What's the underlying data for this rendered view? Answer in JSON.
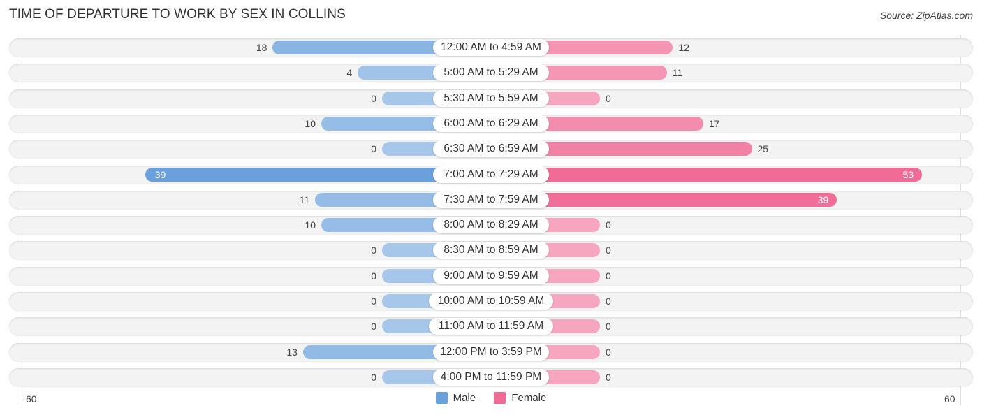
{
  "header": {
    "title": "TIME OF DEPARTURE TO WORK BY SEX IN COLLINS",
    "source": "Source: ZipAtlas.com"
  },
  "colors": {
    "male": "#6aa1dc",
    "male_light": "#a6c7ea",
    "female": "#f06b95",
    "female_light": "#f6a6bf"
  },
  "chart_data": {
    "type": "bar",
    "orientation": "horizontal-diverging",
    "title": "TIME OF DEPARTURE TO WORK BY SEX IN COLLINS",
    "categories": [
      "12:00 AM to 4:59 AM",
      "5:00 AM to 5:29 AM",
      "5:30 AM to 5:59 AM",
      "6:00 AM to 6:29 AM",
      "6:30 AM to 6:59 AM",
      "7:00 AM to 7:29 AM",
      "7:30 AM to 7:59 AM",
      "8:00 AM to 8:29 AM",
      "8:30 AM to 8:59 AM",
      "9:00 AM to 9:59 AM",
      "10:00 AM to 10:59 AM",
      "11:00 AM to 11:59 AM",
      "12:00 PM to 3:59 PM",
      "4:00 PM to 11:59 PM"
    ],
    "series": [
      {
        "name": "Male",
        "values": [
          18,
          4,
          0,
          10,
          0,
          39,
          11,
          10,
          0,
          0,
          0,
          0,
          13,
          0
        ]
      },
      {
        "name": "Female",
        "values": [
          12,
          11,
          0,
          17,
          25,
          53,
          39,
          0,
          0,
          0,
          0,
          0,
          0,
          0
        ]
      }
    ],
    "xlim": [
      -60,
      60
    ],
    "tick_labels": {
      "left": "60",
      "right": "60"
    },
    "legend": {
      "position": "bottom-center",
      "entries": [
        "Male",
        "Female"
      ]
    },
    "grid": false
  }
}
